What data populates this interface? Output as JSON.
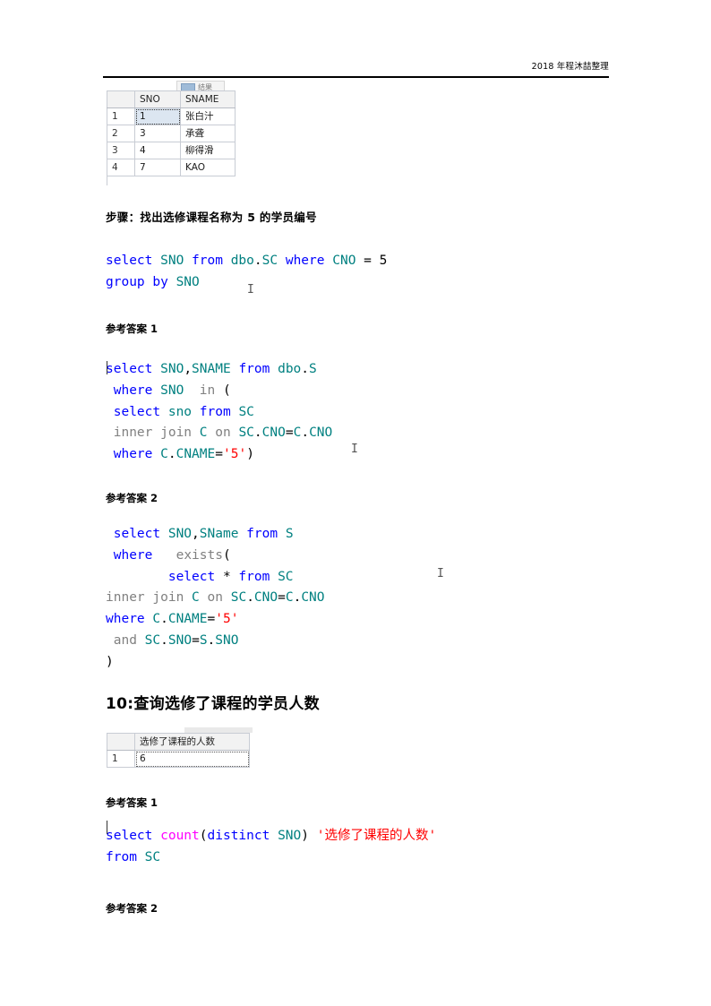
{
  "header": {
    "text": "2018 年程沐喆整理"
  },
  "result_grid_1": {
    "row_header": "",
    "columns": [
      "SNO",
      "SNAME"
    ],
    "rows": [
      {
        "num": "1",
        "SNO": "1",
        "SNAME": "张白汁"
      },
      {
        "num": "2",
        "SNO": "3",
        "SNAME": "承聋"
      },
      {
        "num": "3",
        "SNO": "4",
        "SNAME": "柳得滑"
      },
      {
        "num": "4",
        "SNO": "7",
        "SNAME": "KAO"
      }
    ]
  },
  "step_heading": "步骤：找出选修课程名称为 5 的学员编号",
  "code_step": {
    "lines": [
      [
        {
          "t": "select ",
          "c": "k"
        },
        {
          "t": "SNO",
          "c": "id"
        },
        {
          "t": " ",
          "c": "p"
        },
        {
          "t": "from",
          "c": "k"
        },
        {
          "t": " ",
          "c": "p"
        },
        {
          "t": "dbo",
          "c": "id"
        },
        {
          "t": ".",
          "c": "p"
        },
        {
          "t": "SC",
          "c": "id"
        },
        {
          "t": " ",
          "c": "p"
        },
        {
          "t": "where",
          "c": "k"
        },
        {
          "t": " ",
          "c": "p"
        },
        {
          "t": "CNO",
          "c": "id"
        },
        {
          "t": " = 5",
          "c": "p"
        }
      ],
      [
        {
          "t": "group by ",
          "c": "k"
        },
        {
          "t": "SNO",
          "c": "id"
        }
      ]
    ]
  },
  "answer_label_1a": "参考答案 1",
  "code_answer_1a": {
    "lines": [
      [
        {
          "t": "select ",
          "c": "k"
        },
        {
          "t": "SNO",
          "c": "id"
        },
        {
          "t": ",",
          "c": "p"
        },
        {
          "t": "SNAME",
          "c": "id"
        },
        {
          "t": " ",
          "c": "p"
        },
        {
          "t": "from",
          "c": "k"
        },
        {
          "t": " ",
          "c": "p"
        },
        {
          "t": "dbo",
          "c": "id"
        },
        {
          "t": ".",
          "c": "p"
        },
        {
          "t": "S",
          "c": "id"
        }
      ],
      [
        {
          "t": " ",
          "c": "p"
        },
        {
          "t": "where",
          "c": "k"
        },
        {
          "t": " ",
          "c": "p"
        },
        {
          "t": "SNO",
          "c": "id"
        },
        {
          "t": "  ",
          "c": "p"
        },
        {
          "t": "in",
          "c": "g"
        },
        {
          "t": " (",
          "c": "p"
        }
      ],
      [
        {
          "t": " ",
          "c": "p"
        },
        {
          "t": "select ",
          "c": "k"
        },
        {
          "t": "sno",
          "c": "id"
        },
        {
          "t": " ",
          "c": "p"
        },
        {
          "t": "from",
          "c": "k"
        },
        {
          "t": " ",
          "c": "p"
        },
        {
          "t": "SC",
          "c": "id"
        }
      ],
      [
        {
          "t": " ",
          "c": "p"
        },
        {
          "t": "inner join",
          "c": "g"
        },
        {
          "t": " ",
          "c": "p"
        },
        {
          "t": "C",
          "c": "id"
        },
        {
          "t": " ",
          "c": "p"
        },
        {
          "t": "on",
          "c": "g"
        },
        {
          "t": " ",
          "c": "p"
        },
        {
          "t": "SC",
          "c": "id"
        },
        {
          "t": ".",
          "c": "p"
        },
        {
          "t": "CNO",
          "c": "id"
        },
        {
          "t": "=",
          "c": "p"
        },
        {
          "t": "C",
          "c": "id"
        },
        {
          "t": ".",
          "c": "p"
        },
        {
          "t": "CNO",
          "c": "id"
        }
      ],
      [
        {
          "t": " ",
          "c": "p"
        },
        {
          "t": "where",
          "c": "k"
        },
        {
          "t": " ",
          "c": "p"
        },
        {
          "t": "C",
          "c": "id"
        },
        {
          "t": ".",
          "c": "p"
        },
        {
          "t": "CNAME",
          "c": "id"
        },
        {
          "t": "=",
          "c": "p"
        },
        {
          "t": "'5'",
          "c": "s"
        },
        {
          "t": ")",
          "c": "p"
        }
      ]
    ]
  },
  "answer_label_1b": "参考答案 2",
  "code_answer_1b": {
    "lines": [
      [
        {
          "t": " ",
          "c": "p"
        },
        {
          "t": "select ",
          "c": "k"
        },
        {
          "t": "SNO",
          "c": "id"
        },
        {
          "t": ",",
          "c": "p"
        },
        {
          "t": "SName",
          "c": "id"
        },
        {
          "t": " ",
          "c": "p"
        },
        {
          "t": "from",
          "c": "k"
        },
        {
          "t": " ",
          "c": "p"
        },
        {
          "t": "S",
          "c": "id"
        }
      ],
      [
        {
          "t": " ",
          "c": "p"
        },
        {
          "t": "where",
          "c": "k"
        },
        {
          "t": "   ",
          "c": "p"
        },
        {
          "t": "exists",
          "c": "g"
        },
        {
          "t": "(",
          "c": "p"
        }
      ],
      [
        {
          "t": "        ",
          "c": "p"
        },
        {
          "t": "select ",
          "c": "k"
        },
        {
          "t": "* ",
          "c": "p"
        },
        {
          "t": "from",
          "c": "k"
        },
        {
          "t": " ",
          "c": "p"
        },
        {
          "t": "SC",
          "c": "id"
        }
      ],
      [
        {
          "t": "inner join",
          "c": "g"
        },
        {
          "t": " ",
          "c": "p"
        },
        {
          "t": "C",
          "c": "id"
        },
        {
          "t": " ",
          "c": "p"
        },
        {
          "t": "on",
          "c": "g"
        },
        {
          "t": " ",
          "c": "p"
        },
        {
          "t": "SC",
          "c": "id"
        },
        {
          "t": ".",
          "c": "p"
        },
        {
          "t": "CNO",
          "c": "id"
        },
        {
          "t": "=",
          "c": "p"
        },
        {
          "t": "C",
          "c": "id"
        },
        {
          "t": ".",
          "c": "p"
        },
        {
          "t": "CNO",
          "c": "id"
        }
      ],
      [
        {
          "t": "where",
          "c": "k"
        },
        {
          "t": " ",
          "c": "p"
        },
        {
          "t": "C",
          "c": "id"
        },
        {
          "t": ".",
          "c": "p"
        },
        {
          "t": "CNAME",
          "c": "id"
        },
        {
          "t": "=",
          "c": "p"
        },
        {
          "t": "'5'",
          "c": "s"
        }
      ],
      [
        {
          "t": " ",
          "c": "p"
        },
        {
          "t": "and",
          "c": "g"
        },
        {
          "t": " ",
          "c": "p"
        },
        {
          "t": "SC",
          "c": "id"
        },
        {
          "t": ".",
          "c": "p"
        },
        {
          "t": "SNO",
          "c": "id"
        },
        {
          "t": "=",
          "c": "p"
        },
        {
          "t": "S",
          "c": "id"
        },
        {
          "t": ".",
          "c": "p"
        },
        {
          "t": "SNO",
          "c": "id"
        }
      ],
      [
        {
          "t": ")",
          "c": "p"
        }
      ]
    ]
  },
  "section_heading": "10:查询选修了课程的学员人数",
  "result_grid_2": {
    "columns": [
      "选修了课程的人数"
    ],
    "rows": [
      {
        "num": "1",
        "value": "6"
      }
    ]
  },
  "answer_label_2a": "参考答案 1",
  "code_answer_2a": {
    "lines": [
      [
        {
          "t": "select ",
          "c": "k"
        },
        {
          "t": "count",
          "c": "f"
        },
        {
          "t": "(",
          "c": "p"
        },
        {
          "t": "distinct ",
          "c": "k"
        },
        {
          "t": "SNO",
          "c": "id"
        },
        {
          "t": ") ",
          "c": "p"
        },
        {
          "t": "'选修了课程的人数'",
          "c": "s"
        }
      ],
      [
        {
          "t": "from",
          "c": "k"
        },
        {
          "t": " ",
          "c": "p"
        },
        {
          "t": "SC",
          "c": "id"
        }
      ]
    ]
  },
  "answer_label_2b": "参考答案 2"
}
